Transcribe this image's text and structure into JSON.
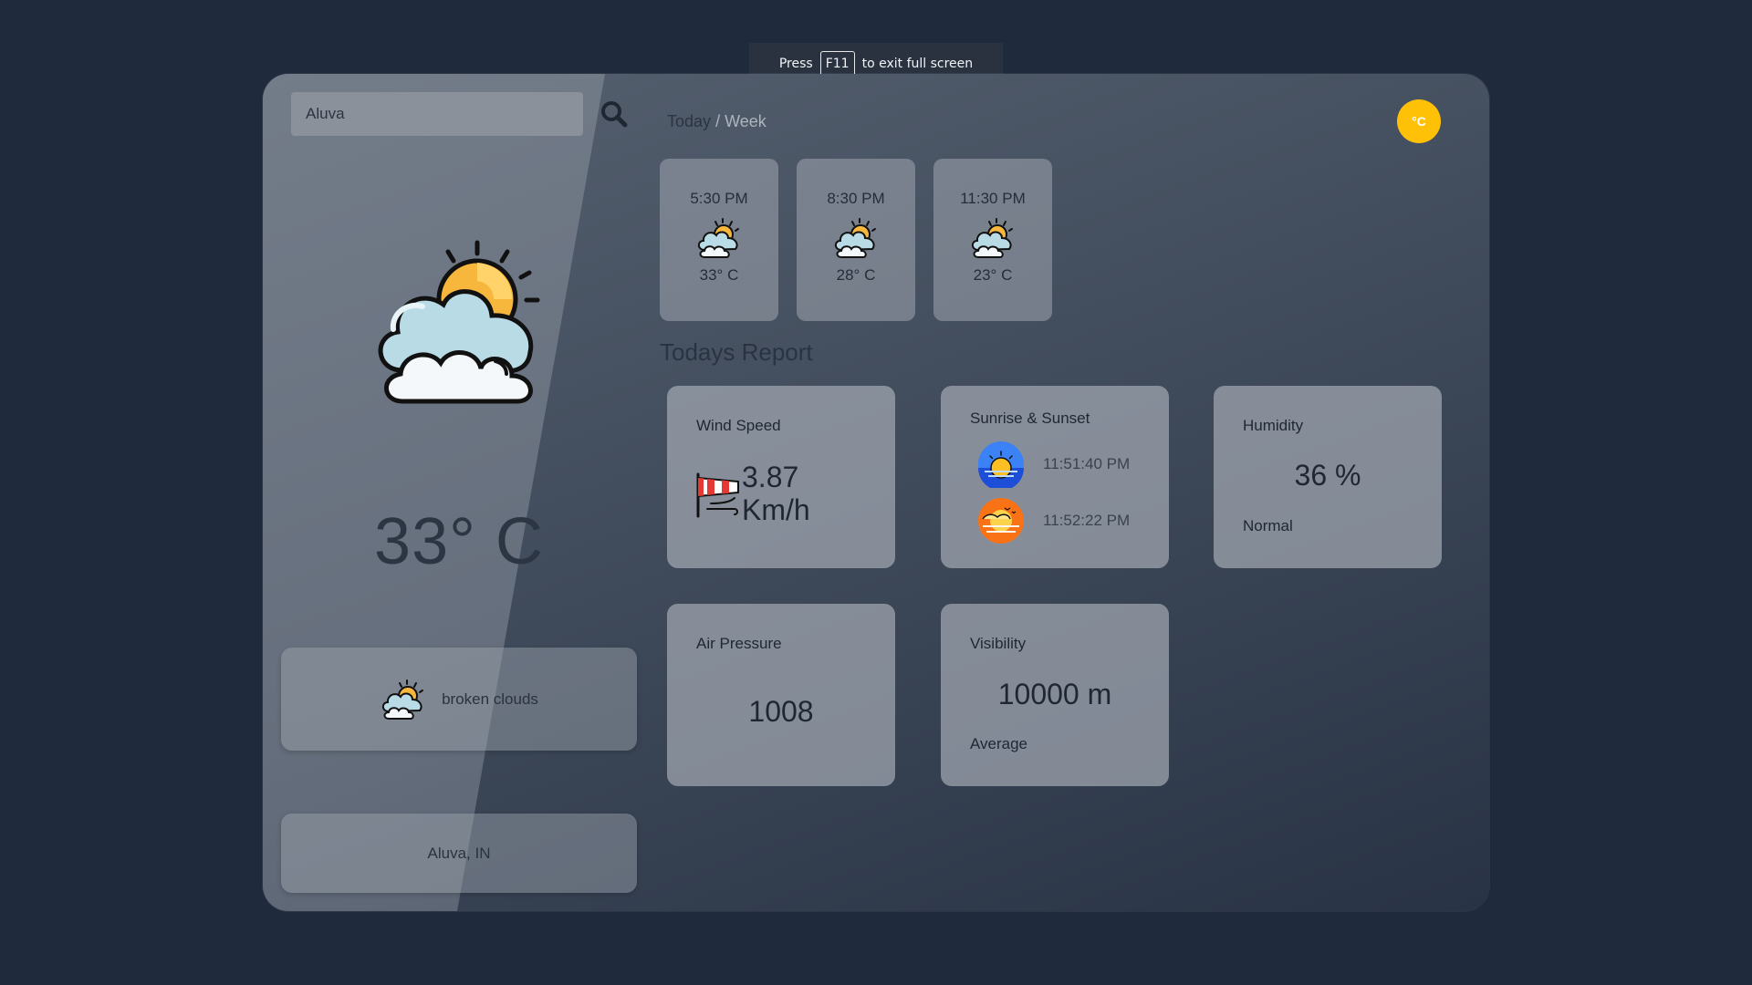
{
  "toast": {
    "press": "Press",
    "key": "F11",
    "suffix": "to exit full screen"
  },
  "search": {
    "value": "Aluva",
    "placeholder": "Aluva"
  },
  "current": {
    "temperature": "33° C",
    "description": "broken clouds",
    "location": "Aluva, IN"
  },
  "view_toggle": {
    "today": "Today",
    "separator": "/",
    "week": "Week"
  },
  "unit_button": "°C",
  "hourly": [
    {
      "time": "5:30 PM",
      "temp": "33° C",
      "icon": "partly-cloudy-icon"
    },
    {
      "time": "8:30 PM",
      "temp": "28° C",
      "icon": "partly-cloudy-icon"
    },
    {
      "time": "11:30 PM",
      "temp": "23° C",
      "icon": "partly-cloudy-icon"
    }
  ],
  "report": {
    "title": "Todays Report",
    "wind": {
      "label": "Wind Speed",
      "value": "3.87",
      "unit": "Km/h"
    },
    "sun": {
      "label": "Sunrise & Sunset",
      "sunrise": "11:51:40 PM",
      "sunset": "11:52:22 PM"
    },
    "humidity": {
      "label": "Humidity",
      "value": "36 %",
      "status": "Normal"
    },
    "pressure": {
      "label": "Air Pressure",
      "value": "1008"
    },
    "visibility": {
      "label": "Visibility",
      "value": "10000 m",
      "status": "Average"
    }
  },
  "colors": {
    "accent": "#ffc107",
    "background": "#1f2a3c"
  }
}
